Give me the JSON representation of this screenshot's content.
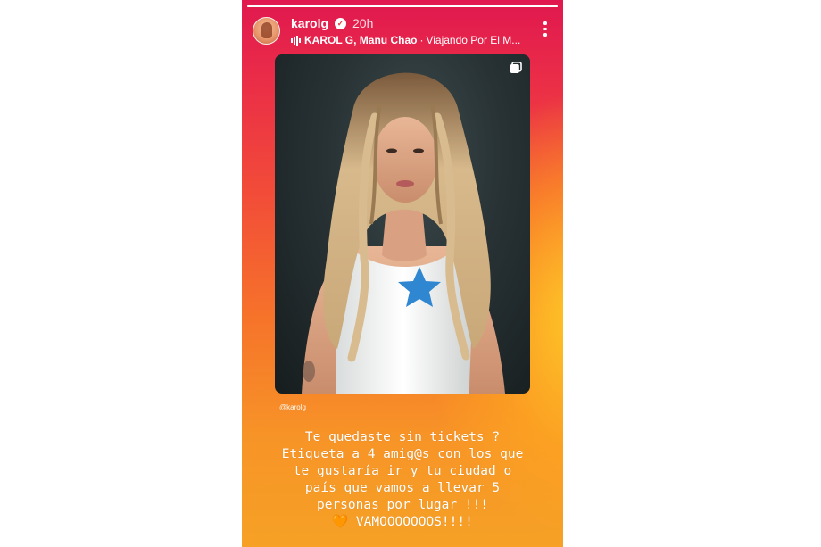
{
  "story": {
    "progress": 1.0,
    "header": {
      "username": "karolg",
      "time": "20h",
      "music": {
        "artists": "KAROL G, Manu Chao",
        "separator": "·",
        "song": "Viajando Por El M..."
      }
    },
    "post": {
      "credit": "@karolg"
    },
    "caption": {
      "lines": [
        "Te quedaste sin tickets ?",
        "Etiqueta a 4 amig@s con los que",
        "te gustaría ir y tu ciudad o",
        "país que vamos a llevar 5",
        "personas por lugar !!!",
        "🧡 VAMOOOOOOOS!!!!"
      ]
    }
  },
  "colors": {
    "gradient_top": "#e0184f",
    "gradient_mid": "#f24d38",
    "gradient_bottom": "#f6a126",
    "glow": "#ffd228",
    "shirt_star": "#2f86d1"
  },
  "icons": [
    "verified-badge-icon",
    "music-equalizer-icon",
    "more-options-icon",
    "carousel-icon"
  ]
}
